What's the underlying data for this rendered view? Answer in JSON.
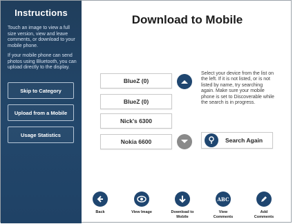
{
  "sidebar": {
    "title": "Instructions",
    "para1": "Touch an image to view a full size version, view and leave comments, or download to your mobile phone.",
    "para2": "If your mobile phone can send photos using Bluetooth, you can upload directly to the display.",
    "buttons": [
      {
        "label": "Skip to Category"
      },
      {
        "label": "Upload from a Mobile"
      },
      {
        "label": "Usage Statistics"
      }
    ],
    "bg_color": "#23476b"
  },
  "main": {
    "title": "Download to Mobile",
    "devices": [
      {
        "label": "BlueZ (0)"
      },
      {
        "label": "BlueZ (0)"
      },
      {
        "label": "Nick's 6300"
      },
      {
        "label": "Nokia 6600"
      }
    ],
    "info": "Select your device from the list on the left. If it is not listed, or is not listed by name, try searching again. Make sure your mobile phone is set to Discoverable while the search is in progress.",
    "search_label": "Search Again",
    "scroll_up_icon": "chevron-up-icon",
    "scroll_down_icon": "chevron-down-icon"
  },
  "toolbar": {
    "items": [
      {
        "label": "Back",
        "icon": "arrow-left-icon"
      },
      {
        "label": "View Image",
        "icon": "eye-icon"
      },
      {
        "label": "Download to Mobile",
        "icon": "arrow-down-icon"
      },
      {
        "label": "View Comments",
        "icon": "abc-icon"
      },
      {
        "label": "Add Comments",
        "icon": "pen-icon"
      }
    ]
  },
  "colors": {
    "accent": "#1f4670",
    "disabled": "#8a8a8a"
  }
}
